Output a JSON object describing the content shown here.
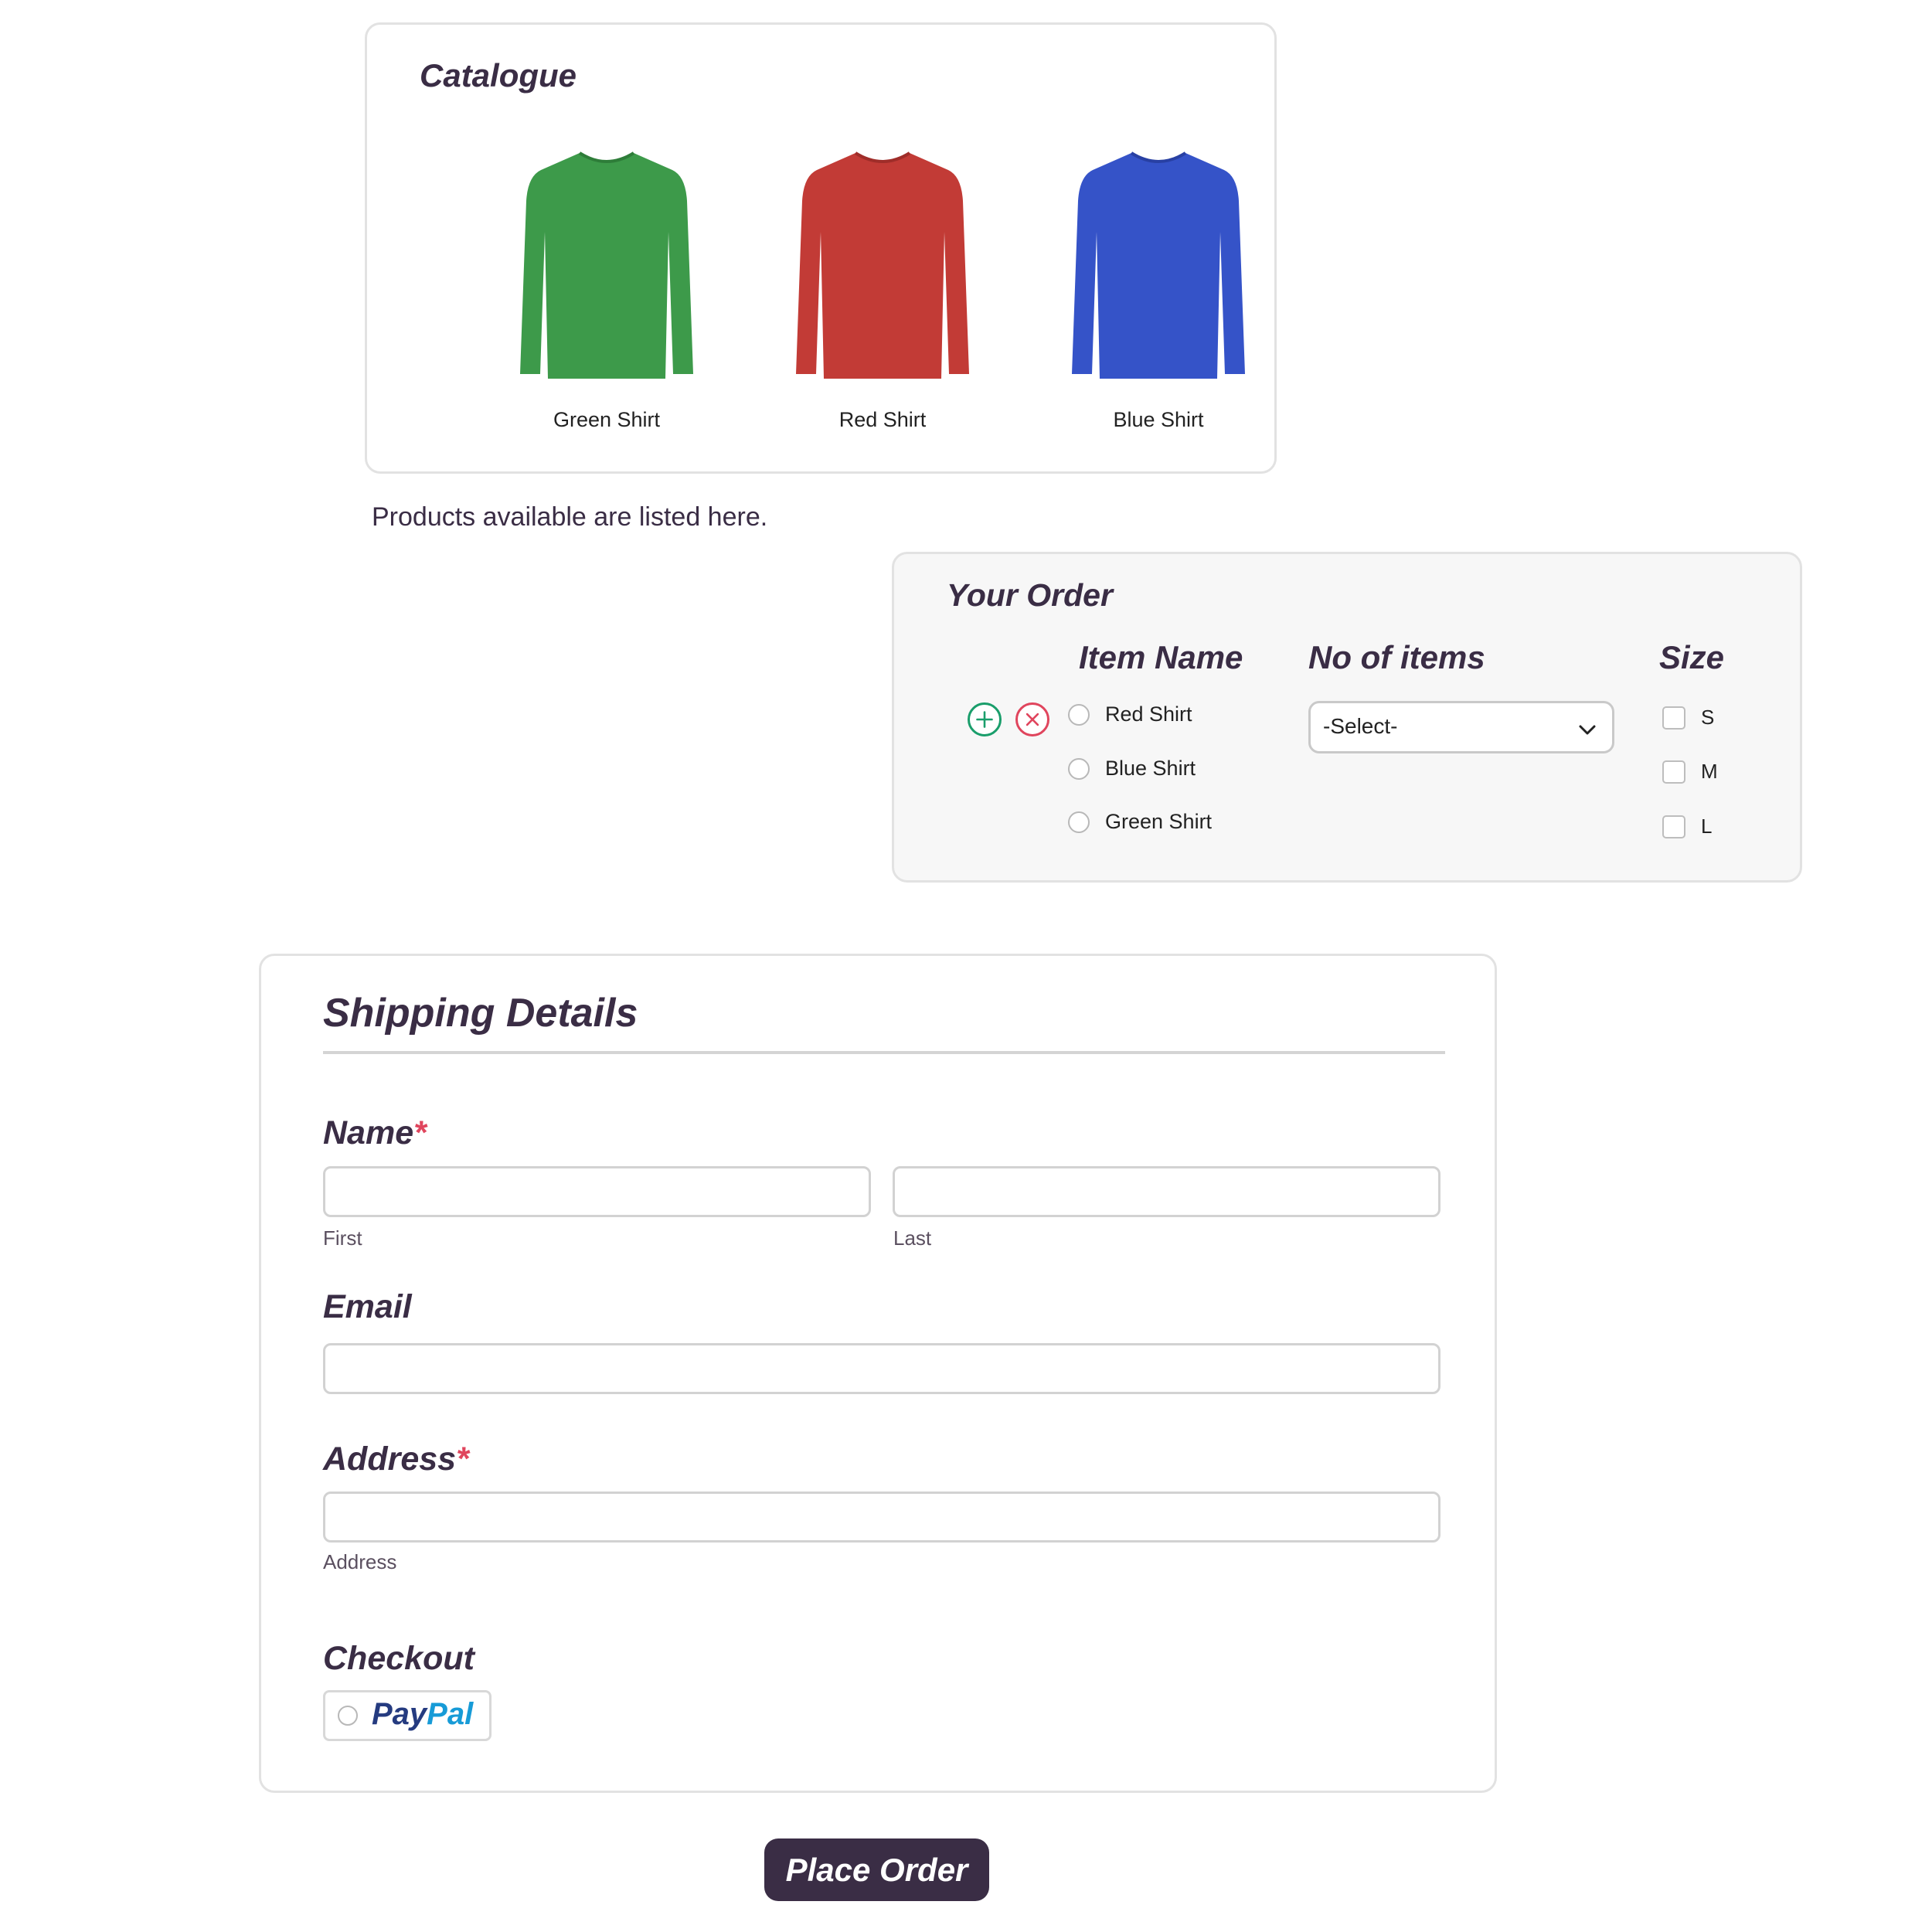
{
  "catalogue": {
    "title": "Catalogue",
    "products": [
      {
        "name": "Green Shirt",
        "color": "#3d9a4a"
      },
      {
        "name": "Red Shirt",
        "color": "#c23b36"
      },
      {
        "name": "Blue Shirt",
        "color": "#3553c8"
      }
    ],
    "note": "Products available are listed here."
  },
  "order": {
    "title": "Your Order",
    "headers": {
      "item_name": "Item Name",
      "no_of_items": "No of items",
      "size": "Size"
    },
    "items": [
      "Red Shirt",
      "Blue Shirt",
      "Green Shirt"
    ],
    "quantity_select": "-Select-",
    "sizes": [
      "S",
      "M",
      "L"
    ],
    "add_icon": "plus-circle-icon",
    "remove_icon": "x-circle-icon",
    "add_color": "#1a9e6b",
    "remove_color": "#e0455d"
  },
  "shipping": {
    "title": "Shipping Details",
    "name_label": "Name",
    "required_mark": "*",
    "first_sublabel": "First",
    "last_sublabel": "Last",
    "email_label": "Email",
    "address_label": "Address",
    "address_sublabel": "Address",
    "checkout_label": "Checkout",
    "paypal": {
      "pay": "Pay",
      "pal": "Pal"
    }
  },
  "submit_label": "Place Order",
  "colors": {
    "brand": "#3a2d45",
    "required": "#e0455d"
  }
}
